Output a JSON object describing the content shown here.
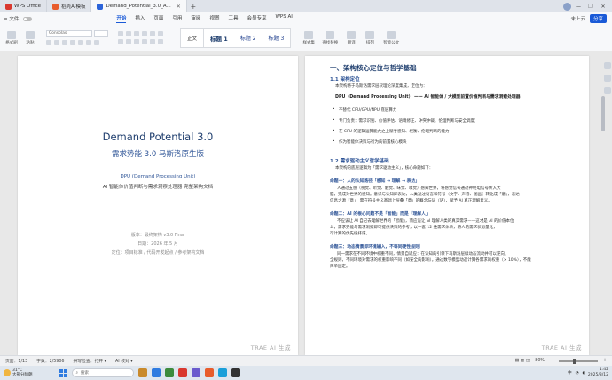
{
  "tabs": [
    {
      "label": "WPS Office",
      "color": "#d9382f",
      "active": false
    },
    {
      "label": "稻壳AI模板",
      "color": "#e85c2c",
      "active": false
    },
    {
      "label": "Demand_Potential_3.0_A...",
      "color": "#2b63d9",
      "active": true
    }
  ],
  "window": {
    "minimize": "—",
    "restore": "❐",
    "close": "✕"
  },
  "menubar": {
    "file_label": "≡ 文件",
    "items": [
      "开始",
      "插入",
      "页面",
      "引用",
      "审阅",
      "视图",
      "工具",
      "会员专享",
      "WPS AI"
    ],
    "active_index": 0,
    "unsaved": "未上云",
    "share": "分享"
  },
  "ribbon": {
    "left_buttons": [
      "格式刷",
      "粘贴"
    ],
    "font_name": "Consolas",
    "styles": [
      "正文",
      "标题 1",
      "标题 2",
      "标题 3"
    ],
    "right_buttons": [
      "样式集",
      "查找替换",
      "翻译",
      "排列",
      "智能公文"
    ]
  },
  "left_page": {
    "title": "Demand Potential 3.0",
    "subtitle": "需求势能 3.0 马斯洛原生版",
    "line1": "DPU (Demand Processing Unit)",
    "line2": "AI 智能体价值判断与需求洞察处理器 完整架构文档",
    "version": "版本：最终架构 v3.0 Final",
    "date": "日期：2026 年 5 月",
    "positioning": "定位：项目标准 / 代码开发起点 / 参考架构文档",
    "watermark": "TRAE AI 生成"
  },
  "right_page": {
    "h1": "一、架构核心定位与哲学基础",
    "h2_1": "1.1 架构定位",
    "p1": "本架构将于马斯洛需求层次理论深度集成，定位为：",
    "dpu_line": "DPU（Demand Processing Unit） —— AI 智能体 / 大模型前置价值判断与需求洞察处理器",
    "bullets": [
      "不替代 CPU/GPU/NPU 底层算力",
      "专门负责：需求识别、价值评估、语境修正、冲突仲裁、伦理判断与安全调度",
      "在 CPU 的逻辑运算能力之上赋予感知、权衡、伦理判断的能力",
      "作为智能体决策与行为的前置核心模块"
    ],
    "h2_2": "1.2 需求驱动主义哲学基础",
    "p2": "本架构的底层逻辑为「需求驱动主义」，核心命题如下：",
    "thesis1_label": "命题一：人的认知路径「感知 → 理解 → 表达」",
    "thesis1_text": [
      "人通过五感（视觉、听觉、触觉、味觉、嗅觉）感知世界，将感觉信号通过神经电信号传入大",
      "脑，完成对世界的感知。意识与认知即表达，人类通过语言和符号（文字、声音、图画）转化成「意」，表达",
      "信息之源「意」，需在符号主义基础上层叠「意」的概念与词（语），赋予 AI 真正理解意义。"
    ],
    "thesis2_label": "命题二：AI 的根心问题不是「智能」而是「理解人」",
    "thesis2_text": [
      "不应该让 AI 自己去理解世界的「智能」，而应该让 AI 理解人类的真实需求——这才是 AI 的价值本位",
      "么，需求势能与需求洞察即可提供决策的参考，以一套 12 维需求体系，将人的需求状态量化，",
      "可计算的优先级排序。"
    ],
    "thesis3_label": "命题三：动态情景即环境输入，不等同硬性规则",
    "thesis3_text": [
      "同一需求在不同环境中权重不同，情景自适应：在认知的引领下马斯洛层级动态流动并可以逆向，",
      "全规则，不同环境对需求的权重影响不同（如安全的影响）。通过数学模型动态计算各需求的权重（× 10%），不能",
      "简单固定。"
    ],
    "watermark": "TRAE AI 生成"
  },
  "statusbar": {
    "page": "页面：1/13",
    "words": "字数：2/5906",
    "spell": "拼写检查：打开 ▾",
    "ai": "AI 校对 ▾",
    "zoom": "80%",
    "zoom_value": 0.8
  },
  "taskbar": {
    "temp": "31°C",
    "weather": "大部分晴朗",
    "search_placeholder": "搜索",
    "time": "1:42",
    "date": "2025/3/12",
    "lang": "中"
  }
}
